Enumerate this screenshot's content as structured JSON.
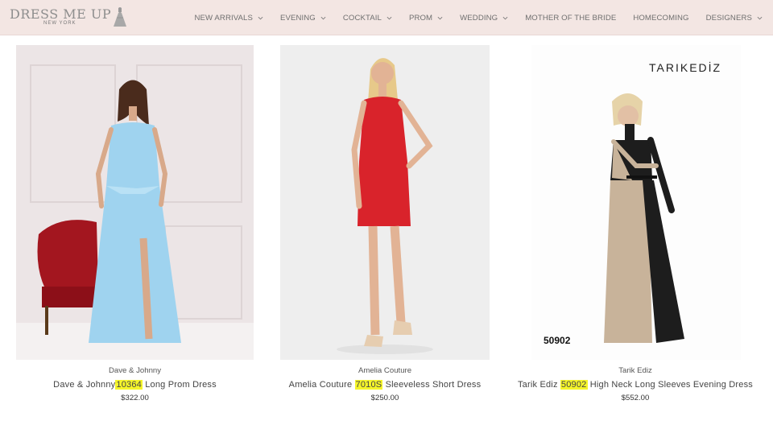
{
  "header": {
    "logo_main": "DRESS ME UP",
    "logo_sub": "NEW YORK",
    "nav": [
      {
        "label": "NEW ARRIVALS",
        "has_dropdown": true
      },
      {
        "label": "EVENING",
        "has_dropdown": true
      },
      {
        "label": "COCKTAIL",
        "has_dropdown": true
      },
      {
        "label": "PROM",
        "has_dropdown": true
      },
      {
        "label": "WEDDING",
        "has_dropdown": true
      },
      {
        "label": "MOTHER OF THE BRIDE",
        "has_dropdown": false
      },
      {
        "label": "HOMECOMING",
        "has_dropdown": false
      },
      {
        "label": "DESIGNERS",
        "has_dropdown": true
      }
    ]
  },
  "products": [
    {
      "brand": "Dave & Johnny",
      "title_prefix": "Dave & Johnny",
      "style_number": "10364",
      "title_suffix": " Long Prom Dress",
      "price": "$322.00",
      "dress_color": "#9fd3ef"
    },
    {
      "brand": "Amelia Couture",
      "title_prefix": "Amelia Couture ",
      "style_number": "7010S",
      "title_suffix": " Sleeveless Short Dress",
      "price": "$250.00",
      "dress_color": "#d9232b"
    },
    {
      "brand": "Tarik Ediz",
      "title_prefix": "Tarik Ediz ",
      "style_number": "50902",
      "title_suffix": " High Neck Long Sleeves Evening Dress",
      "price": "$552.00",
      "dress_color": "#c8b39a",
      "image_logo": "TARIKEDİZ",
      "image_style_label": "50902"
    }
  ],
  "colors": {
    "header_bg": "#f3e6e3",
    "highlight": "#f5f52a"
  }
}
